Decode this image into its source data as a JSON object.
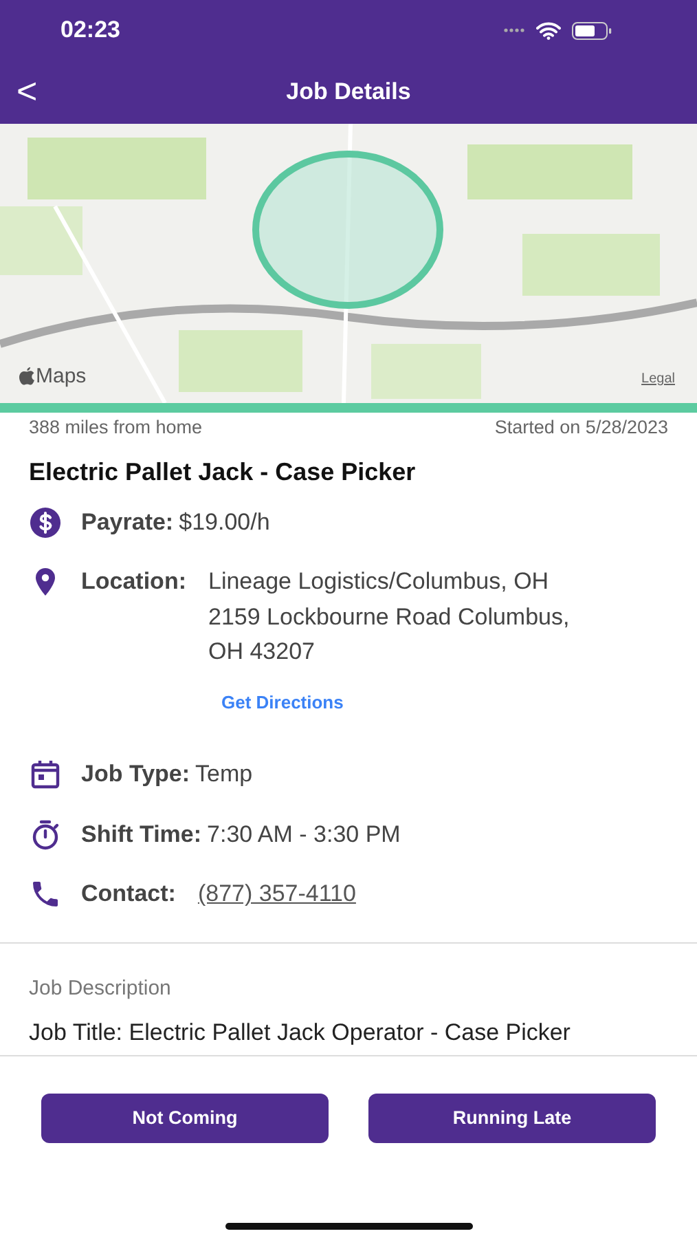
{
  "status_bar": {
    "time": "02:23"
  },
  "header": {
    "back": "<",
    "title": "Job Details"
  },
  "map": {
    "kind": "picture",
    "logo": "Maps",
    "legal": "Legal"
  },
  "meta": {
    "distance": "388 miles from home",
    "started": "Started on 5/28/2023"
  },
  "job_title": "Electric Pallet Jack - Case Picker",
  "details": [
    {
      "kind": "pay",
      "label": "Payrate:",
      "value": "$19.00/h"
    },
    {
      "kind": "location",
      "label": "Location:",
      "lines": [
        "Lineage Logistics/Columbus, OH",
        "2159 Lockbourne Road Columbus,",
        "OH 43207"
      ],
      "link": "Get Directions"
    },
    {
      "kind": "type",
      "label": "Job Type:",
      "value": "Temp"
    },
    {
      "kind": "shift",
      "label": "Shift Time:",
      "value": "7:30 AM - 3:30 PM"
    },
    {
      "kind": "contact",
      "label": "Contact:",
      "phone": "(877) 357-4110"
    }
  ],
  "description": {
    "heading": "Job Description",
    "text": "Job Title: Electric Pallet Jack Operator - Case Picker"
  },
  "buttons": [
    "Not Coming",
    "Running Late"
  ]
}
